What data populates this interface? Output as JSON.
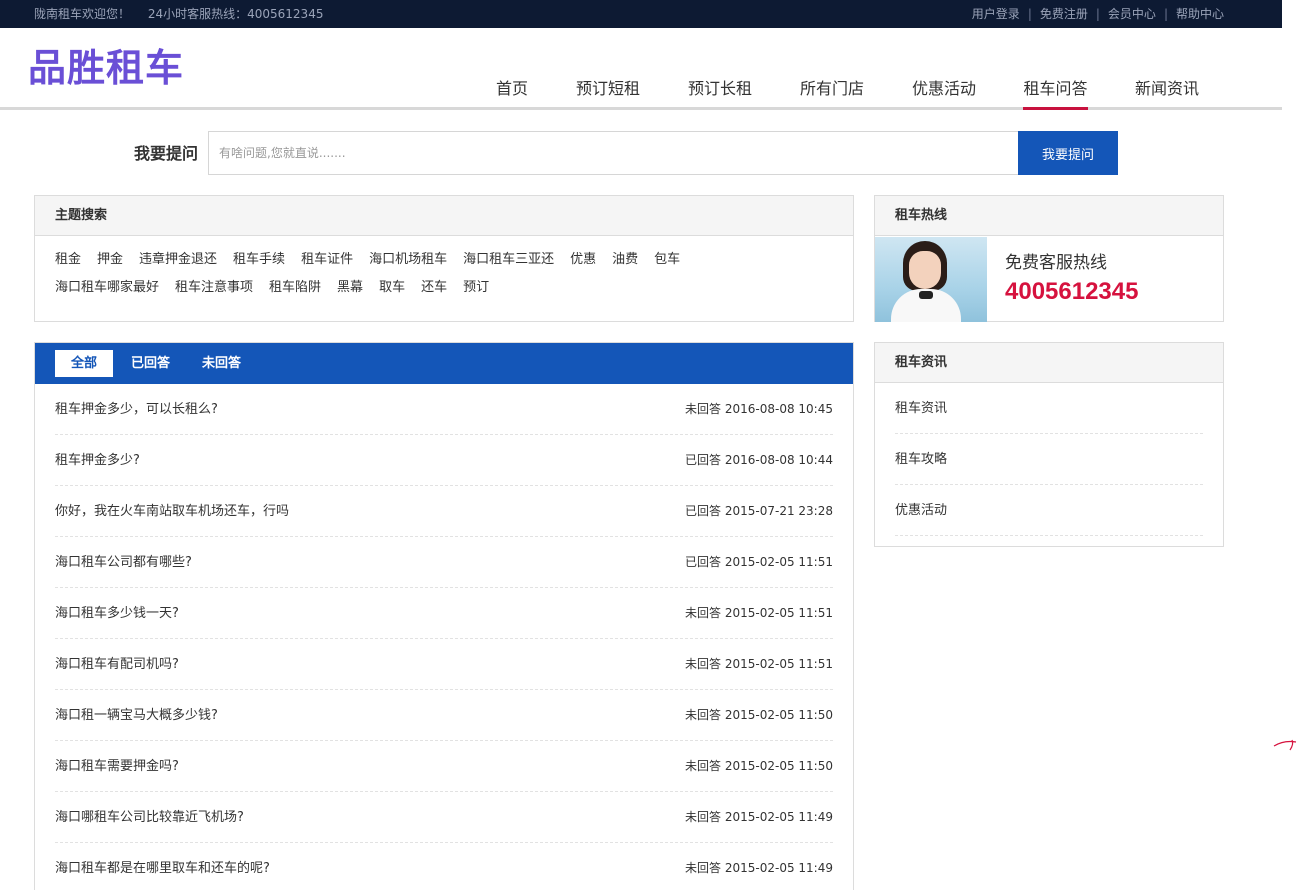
{
  "topbar": {
    "welcome": "陇南租车欢迎您！",
    "hotline": "24小时客服热线：4005612345",
    "links": [
      "用户登录",
      "免费注册",
      "会员中心",
      "帮助中心"
    ]
  },
  "brand": {
    "logo_text": "品胜租车"
  },
  "nav": {
    "items": [
      "首页",
      "预订短租",
      "预订长租",
      "所有门店",
      "优惠活动",
      "租车问答",
      "新闻资讯"
    ],
    "active": "租车问答"
  },
  "ask": {
    "label": "我要提问",
    "placeholder": "有啥问题,您就直说.......",
    "button": "我要提问"
  },
  "topics": {
    "title": "主题搜索",
    "items": [
      "租金",
      "押金",
      "违章押金退还",
      "租车手续",
      "租车证件",
      "海口机场租车",
      "海口租车三亚还",
      "优惠",
      "油费",
      "包车",
      "海口租车哪家最好",
      "租车注意事项",
      "租车陷阱",
      "黑幕",
      "取车",
      "还车",
      "预订"
    ]
  },
  "hotline_panel": {
    "title": "租车热线",
    "label": "免费客服热线",
    "number": "4005612345"
  },
  "questions": {
    "tabs": [
      "全部",
      "已回答",
      "未回答"
    ],
    "active_tab": "全部",
    "rows": [
      {
        "title": "租车押金多少，可以长租么?",
        "status": "未回答",
        "time": "2016-08-08 10:45"
      },
      {
        "title": "租车押金多少?",
        "status": "已回答",
        "time": "2016-08-08 10:44"
      },
      {
        "title": "你好，我在火车南站取车机场还车，行吗",
        "status": "已回答",
        "time": "2015-07-21 23:28"
      },
      {
        "title": "海口租车公司都有哪些?",
        "status": "已回答",
        "time": "2015-02-05 11:51"
      },
      {
        "title": "海口租车多少钱一天?",
        "status": "未回答",
        "time": "2015-02-05 11:51"
      },
      {
        "title": "海口租车有配司机吗?",
        "status": "未回答",
        "time": "2015-02-05 11:51"
      },
      {
        "title": "海口租一辆宝马大概多少钱?",
        "status": "未回答",
        "time": "2015-02-05 11:50"
      },
      {
        "title": "海口租车需要押金吗?",
        "status": "未回答",
        "time": "2015-02-05 11:50"
      },
      {
        "title": "海口哪租车公司比较靠近飞机场?",
        "status": "未回答",
        "time": "2015-02-05 11:49"
      },
      {
        "title": "海口租车都是在哪里取车和还车的呢?",
        "status": "未回答",
        "time": "2015-02-05 11:49"
      }
    ]
  },
  "news": {
    "title": "租车资讯",
    "items": [
      "租车资讯",
      "租车攻略",
      "优惠活动"
    ]
  },
  "colors": {
    "topbar_bg": "#0d1a33",
    "brand": "#6a4fd6",
    "primary": "#1456b8",
    "accent": "#d6123e"
  }
}
